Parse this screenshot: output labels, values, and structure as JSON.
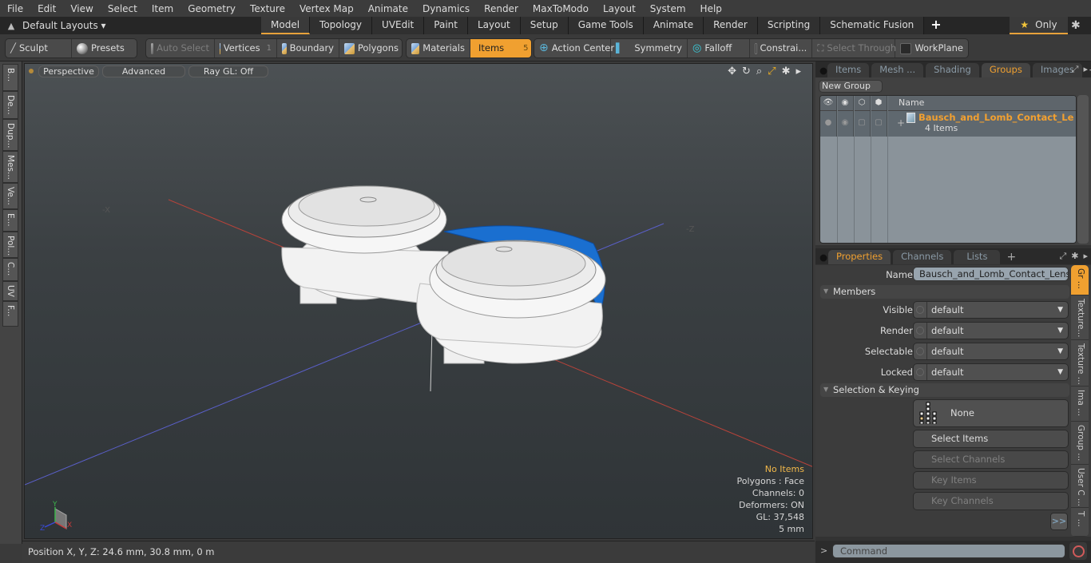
{
  "menu": [
    "File",
    "Edit",
    "View",
    "Select",
    "Item",
    "Geometry",
    "Texture",
    "Vertex Map",
    "Animate",
    "Dynamics",
    "Render",
    "MaxToModo",
    "Layout",
    "System",
    "Help"
  ],
  "layoutbar": {
    "layout_selector": "Default Layouts ▾",
    "tabs": [
      "Model",
      "Topology",
      "UVEdit",
      "Paint",
      "Layout",
      "Setup",
      "Game Tools",
      "Animate",
      "Render",
      "Scripting",
      "Schematic Fusion"
    ],
    "active_tab": "Model",
    "add_tab": "+",
    "only_label": "Only",
    "only_icon": "star-icon"
  },
  "toolbar": {
    "sculpt": "Sculpt",
    "presets": "Presets",
    "auto_select": "Auto Select",
    "vertices": "Vertices",
    "vertices_count": "1",
    "boundary": "Boundary",
    "polygons": "Polygons",
    "materials": "Materials",
    "items": "Items",
    "items_count": "5",
    "action_center": "Action Center",
    "symmetry": "Symmetry",
    "falloff": "Falloff",
    "constraints": "Constrai...",
    "select_through": "Select Through",
    "workplane": "WorkPlane"
  },
  "left_strip": [
    "B...",
    "De...",
    "Dup...",
    "Mes...",
    "Ve...",
    "E...",
    "Pol...",
    "C...",
    "UV",
    "F..."
  ],
  "viewport": {
    "view": "Perspective",
    "shading": "Advanced",
    "raygl": "Ray GL: Off",
    "tool_icons": [
      "move-icon",
      "rotate-icon",
      "zoom-icon",
      "maximize-icon",
      "gear-icon",
      "arrow-right-icon"
    ],
    "axis_labels": {
      "x": "X",
      "y": "Y",
      "z": "Z"
    },
    "info": {
      "selection": "No Items",
      "polygons": "Polygons : Face",
      "channels": "Channels: 0",
      "deformers": "Deformers: ON",
      "gl": "GL: 37,548",
      "scale": "5 mm"
    },
    "model_colors": {
      "body": "#f4f4f4",
      "selected_edge": "#1a6fd0"
    }
  },
  "statusbar": {
    "position": "Position X, Y, Z:   24.6 mm, 30.8 mm, 0 m"
  },
  "groups_panel": {
    "tabs": [
      "Items",
      "Mesh ...",
      "Shading",
      "Groups",
      "Images"
    ],
    "active_tab": "Groups",
    "new_group": "New Group",
    "column_name": "Name",
    "rows": [
      {
        "name": "Bausch_and_Lomb_Contact_Le ...",
        "count": "4 Items"
      }
    ]
  },
  "properties_panel": {
    "tabs": [
      "Properties",
      "Channels",
      "Lists"
    ],
    "active_tab": "Properties",
    "name_label": "Name",
    "name_value": "Bausch_and_Lomb_Contact_Lens_Ca:",
    "members_header": "Members",
    "members": [
      {
        "label": "Visible",
        "value": "default"
      },
      {
        "label": "Render",
        "value": "default"
      },
      {
        "label": "Selectable",
        "value": "default"
      },
      {
        "label": "Locked",
        "value": "default"
      }
    ],
    "selection_header": "Selection & Keying",
    "none_button": "None",
    "select_items": "Select Items",
    "select_channels": "Select Channels",
    "key_items": "Key Items",
    "key_channels": "Key Channels",
    "forward_button": ">>",
    "side_tabs": [
      "Gr ...",
      "Texture...",
      "Texture ...",
      "Ima ...",
      "Group ...",
      "User C ...",
      "T ..."
    ]
  },
  "command": {
    "prompt": ">",
    "placeholder": "Command"
  }
}
